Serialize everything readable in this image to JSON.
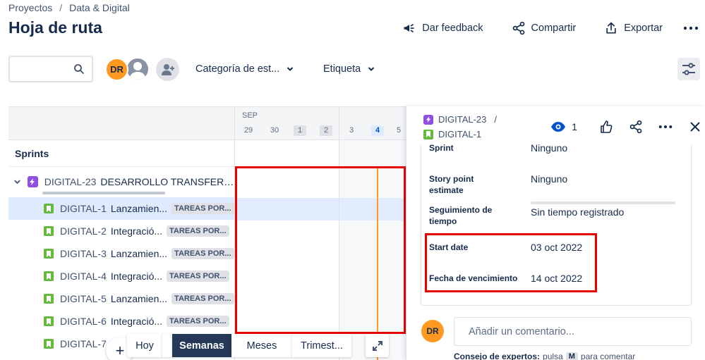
{
  "breadcrumb": [
    "Proyectos",
    "Data & Digital"
  ],
  "breadcrumb_sep": "/",
  "title": "Hoja de ruta",
  "actions": {
    "feedback": "Dar feedback",
    "share": "Compartir",
    "export": "Exportar"
  },
  "filters": {
    "search_placeholder": "",
    "avatar_initials": "DR",
    "category": "Categoría de est...",
    "label": "Etiqueta"
  },
  "left": {
    "sprints_label": "Sprints",
    "epic": {
      "key": "DIGITAL-23",
      "summary": "DESARROLLO TRANSFEREN..."
    },
    "stories": [
      {
        "key": "DIGITAL-1",
        "summary": "Lanzamien...",
        "status": "TAREAS POR..."
      },
      {
        "key": "DIGITAL-2",
        "summary": "Integració...",
        "status": "TAREAS POR..."
      },
      {
        "key": "DIGITAL-3",
        "summary": "Lanzamien...",
        "status": "TAREAS POR..."
      },
      {
        "key": "DIGITAL-4",
        "summary": "Integració...",
        "status": "TAREAS POR..."
      },
      {
        "key": "DIGITAL-5",
        "summary": "Lanzamien...",
        "status": "TAREAS POR..."
      },
      {
        "key": "DIGITAL-6",
        "summary": "Integració...",
        "status": "TAREAS POR..."
      },
      {
        "key": "DIGITAL-7",
        "summary": "",
        "status": ""
      }
    ]
  },
  "timeline": {
    "month": "SEP",
    "days": [
      "29",
      "30",
      "1",
      "2",
      "3",
      "4",
      "5"
    ],
    "today": "4"
  },
  "bottom": {
    "today": "Hoy",
    "weeks": "Semanas",
    "months": "Meses",
    "quarters": "Trimest..."
  },
  "panel": {
    "parent_key": "DIGITAL-23",
    "sep": "/",
    "issue_key": "DIGITAL-1",
    "watchers": "1",
    "fields": {
      "sprint_label": "Sprint",
      "sprint_value": "Ninguno",
      "sp_label": "Story point estimate",
      "sp_value": "Ninguno",
      "tracking_label": "Seguimiento de tiempo",
      "tracking_value": "Sin tiempo registrado",
      "start_label": "Start date",
      "start_value": "03 oct 2022",
      "due_label": "Fecha de vencimiento",
      "due_value": "14 oct 2022"
    },
    "comment_avatar": "DR",
    "comment_placeholder": "Añadir un comentario...",
    "tip_bold": "Consejo de expertos:",
    "tip_pre": "pulsa",
    "tip_key": "M",
    "tip_post": "para comentar"
  },
  "colors": {
    "accent": "#0052cc",
    "epic": "#904ee2",
    "story": "#63ba3c",
    "today_line": "#ff991f",
    "highlight_box": "#e60000",
    "avatar": "#ff991f"
  }
}
